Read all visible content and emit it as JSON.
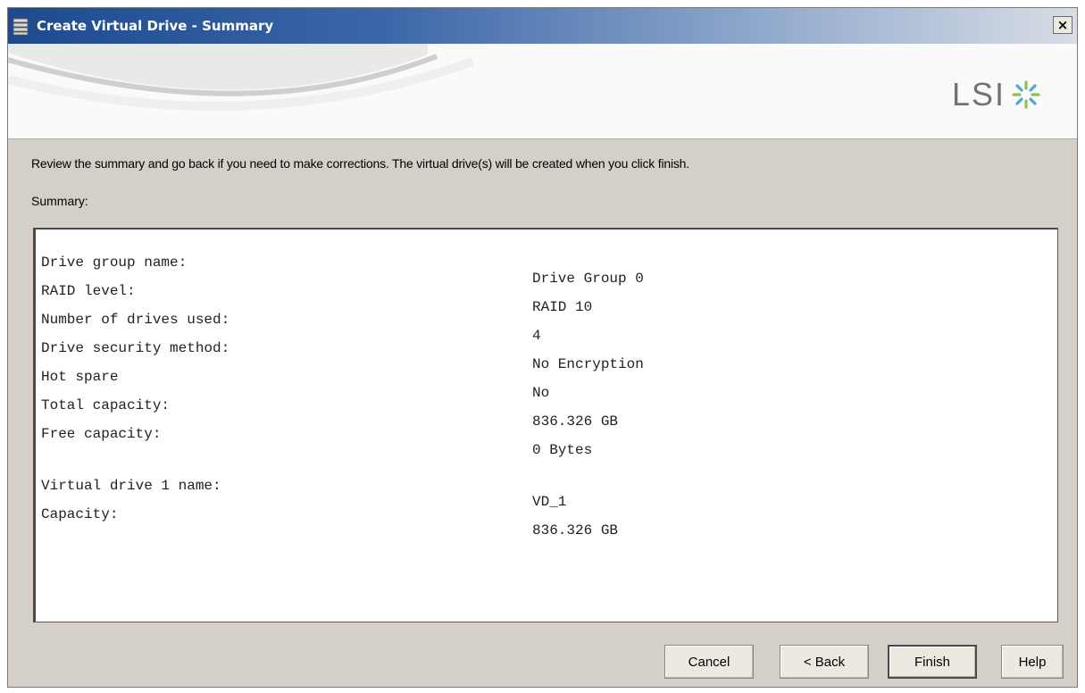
{
  "window": {
    "title": "Create Virtual Drive - Summary",
    "close_label": "×"
  },
  "banner": {
    "logo_text": "LSI",
    "logo_icon": "lsi-starburst-icon"
  },
  "content": {
    "intro_text": "Review the summary and go back if you need to make corrections. The virtual drive(s) will be created when you click finish.",
    "summary_label": "Summary:"
  },
  "summary": {
    "rows": [
      {
        "key": "Drive group name:",
        "value": "Drive Group 0"
      },
      {
        "key": "RAID level:",
        "value": "RAID 10"
      },
      {
        "key": "Number of drives used:",
        "value": "4"
      },
      {
        "key": "Drive security method:",
        "value": "No Encryption"
      },
      {
        "key": "Hot spare",
        "value": "No"
      },
      {
        "key": "Total capacity:",
        "value": "836.326 GB"
      },
      {
        "key": "Free capacity:",
        "value": "0 Bytes"
      },
      {
        "key": "Virtual drive 1 name:",
        "value": "VD_1"
      },
      {
        "key": "Capacity:",
        "value": "836.326 GB"
      }
    ]
  },
  "buttons": {
    "cancel": "Cancel",
    "back": "< Back",
    "finish": "Finish",
    "help": "Help"
  },
  "colors": {
    "titlebar_start": "#1d4a8f",
    "dialog_bg": "#d4d0c8"
  }
}
